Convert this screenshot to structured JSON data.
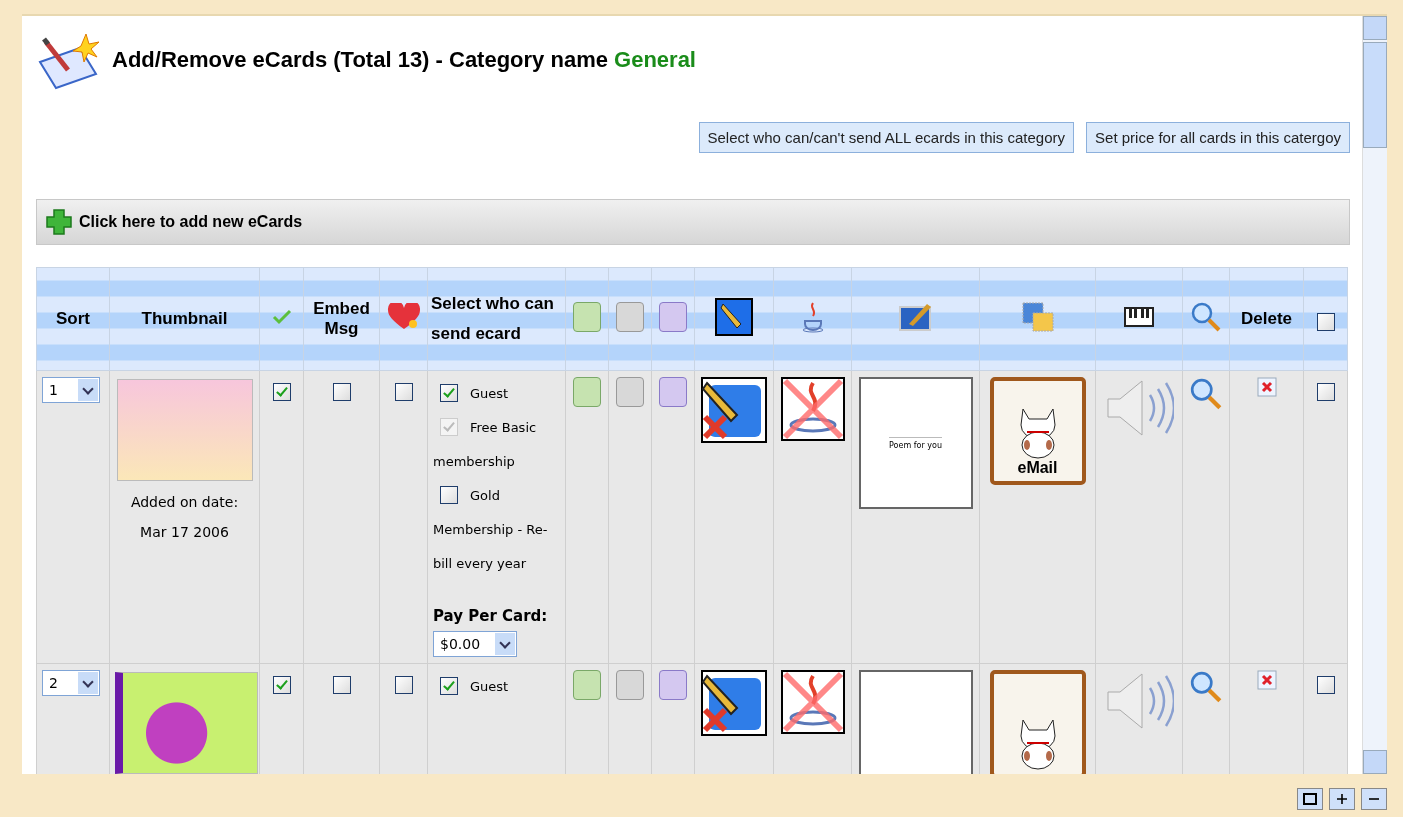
{
  "header": {
    "title": "Add/Remove eCards (Total 13) - Category name",
    "category": "General"
  },
  "actions": [
    "Select who can/can't send ALL ecards in this category",
    "Set price for all cards in this catergoy"
  ],
  "add_bar": {
    "label": "Click here to add new eCards"
  },
  "table": {
    "headers": {
      "sort": "Sort",
      "thumbnail": "Thumbnail",
      "embed": "Embed Msg",
      "who": "Select who can send ecard",
      "delete": "Delete"
    },
    "select_all_checked": false,
    "rows": [
      {
        "sort": "1",
        "added_label": "Added on date:",
        "added_date": "Mar 17 2006",
        "enabled": true,
        "embed": false,
        "favorite": false,
        "access": [
          {
            "label": "Guest",
            "checked": true,
            "disabled": false
          },
          {
            "label": "Free Basic membership",
            "checked": true,
            "disabled": true
          },
          {
            "label": "Gold Membership - Re-bill every year",
            "checked": false,
            "disabled": false
          }
        ],
        "pay_label": "Pay Per Card:",
        "price": "$0.00",
        "preview_text": "Poem for you",
        "stamp_text": "eMail",
        "selected": false
      },
      {
        "sort": "2",
        "enabled": true,
        "embed": false,
        "favorite": false,
        "access": [
          {
            "label": "Guest",
            "checked": true,
            "disabled": false
          }
        ],
        "selected": false
      }
    ]
  }
}
